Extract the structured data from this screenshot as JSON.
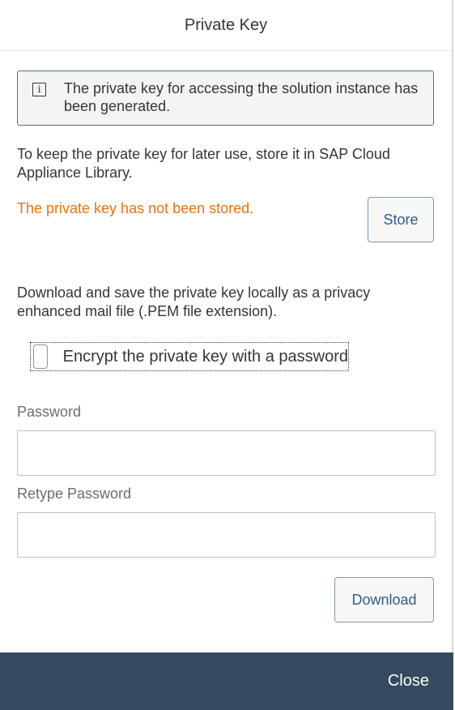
{
  "dialog": {
    "title": "Private Key"
  },
  "info": {
    "icon": "info-icon",
    "glyph": "i",
    "message": "The private key for accessing the solution instance has been generated."
  },
  "store_section": {
    "description": "To keep the private key for later use, store it in SAP Cloud Appliance Library.",
    "warning": "The private key has not been stored.",
    "store_label": "Store"
  },
  "download_section": {
    "description": "Download and save the private key locally as a privacy enhanced mail file (.PEM file extension).",
    "encrypt_label": "Encrypt the private key with a password",
    "encrypt_checked": false,
    "password_label": "Password",
    "password_value": "",
    "retype_label": "Retype Password",
    "retype_value": "",
    "download_label": "Download"
  },
  "footer": {
    "close_label": "Close"
  },
  "colors": {
    "warning": "#e9730c",
    "footer_bg": "#354a5f",
    "button_text": "#2f5c8a"
  }
}
